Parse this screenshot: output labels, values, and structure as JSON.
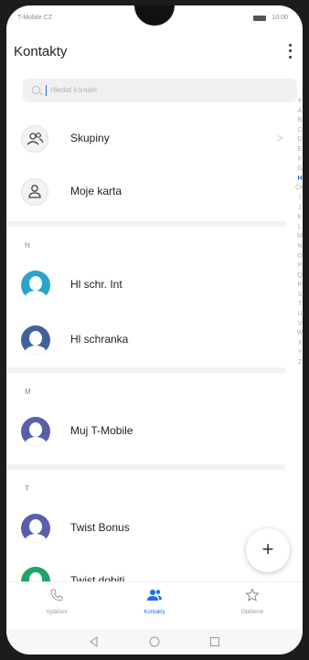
{
  "statusbar": {
    "carrier": "T-Mobile CZ",
    "time": "10:00"
  },
  "header": {
    "title": "Kontakty"
  },
  "search": {
    "placeholder": "Hledat kontakt"
  },
  "groups": [
    {
      "label": "Skupiny",
      "icon": "group-icon"
    },
    {
      "label": "Moje karta",
      "icon": "person-icon"
    }
  ],
  "sections": [
    {
      "letter": "H",
      "contacts": [
        {
          "name": "Hl schr. Int",
          "color": "#29a3c9"
        },
        {
          "name": "Hl schranka",
          "color": "#43609e"
        }
      ]
    },
    {
      "letter": "M",
      "contacts": [
        {
          "name": "Muj T-Mobile",
          "color": "#5b5ea8"
        }
      ]
    },
    {
      "letter": "T",
      "contacts": [
        {
          "name": "Twist Bonus",
          "color": "#5b5ea8"
        },
        {
          "name": "Twist dobiti",
          "color": "#21a36a"
        }
      ]
    }
  ],
  "alphabet": [
    "#",
    "A",
    "B",
    "C",
    "D",
    "E",
    "F",
    "G",
    "H",
    "CH",
    "I",
    "J",
    "K",
    "L",
    "M",
    "N",
    "O",
    "P",
    "Q",
    "R",
    "S",
    "T",
    "U",
    "V",
    "W",
    "X",
    "Y",
    "Z"
  ],
  "alphabet_active": "H",
  "nav": {
    "calls": "Vytáčení",
    "contacts": "Kontakty",
    "favorites": "Oblíbené"
  },
  "accent": "#1e6ef0"
}
